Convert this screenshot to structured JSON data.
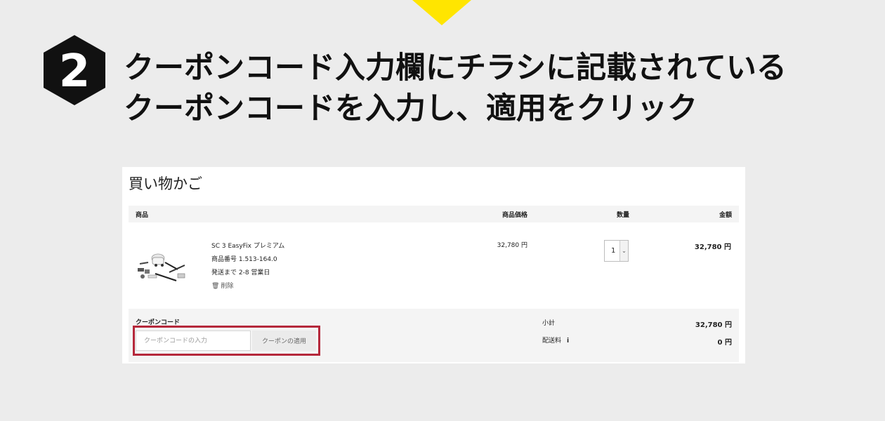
{
  "step": {
    "number": "2",
    "heading_line1": "クーポンコード入力欄にチラシに記載されている",
    "heading_line2": "クーポンコードを入力し、適用をクリック"
  },
  "cart": {
    "title": "買い物かご",
    "columns": {
      "product": "商品",
      "price": "商品価格",
      "quantity": "数量",
      "total": "金額"
    },
    "item": {
      "name": "SC 3 EasyFix プレミアム",
      "number": "商品番号 1.513-164.0",
      "shipping": "発送まで 2-8 営業日",
      "delete": "削除",
      "unit_price": "32,780 円",
      "quantity": "1",
      "line_total": "32,780 円"
    },
    "coupon": {
      "label": "クーポンコード",
      "placeholder": "クーポンコードの入力",
      "value": "",
      "apply": "クーポンの適用"
    },
    "summary": {
      "subtotal_label": "小計",
      "subtotal": "32,780 円",
      "shipping_label": "配送料",
      "info_icon": "i",
      "shipping": "0 円"
    }
  },
  "colors": {
    "background": "#ececec",
    "arrow": "#ffe500",
    "badge": "#111111",
    "highlight": "#b5283b"
  },
  "icons": [
    "down-arrow-indicator",
    "hexagon-step-badge",
    "trash-icon",
    "chevron-down-icon",
    "info-icon"
  ]
}
